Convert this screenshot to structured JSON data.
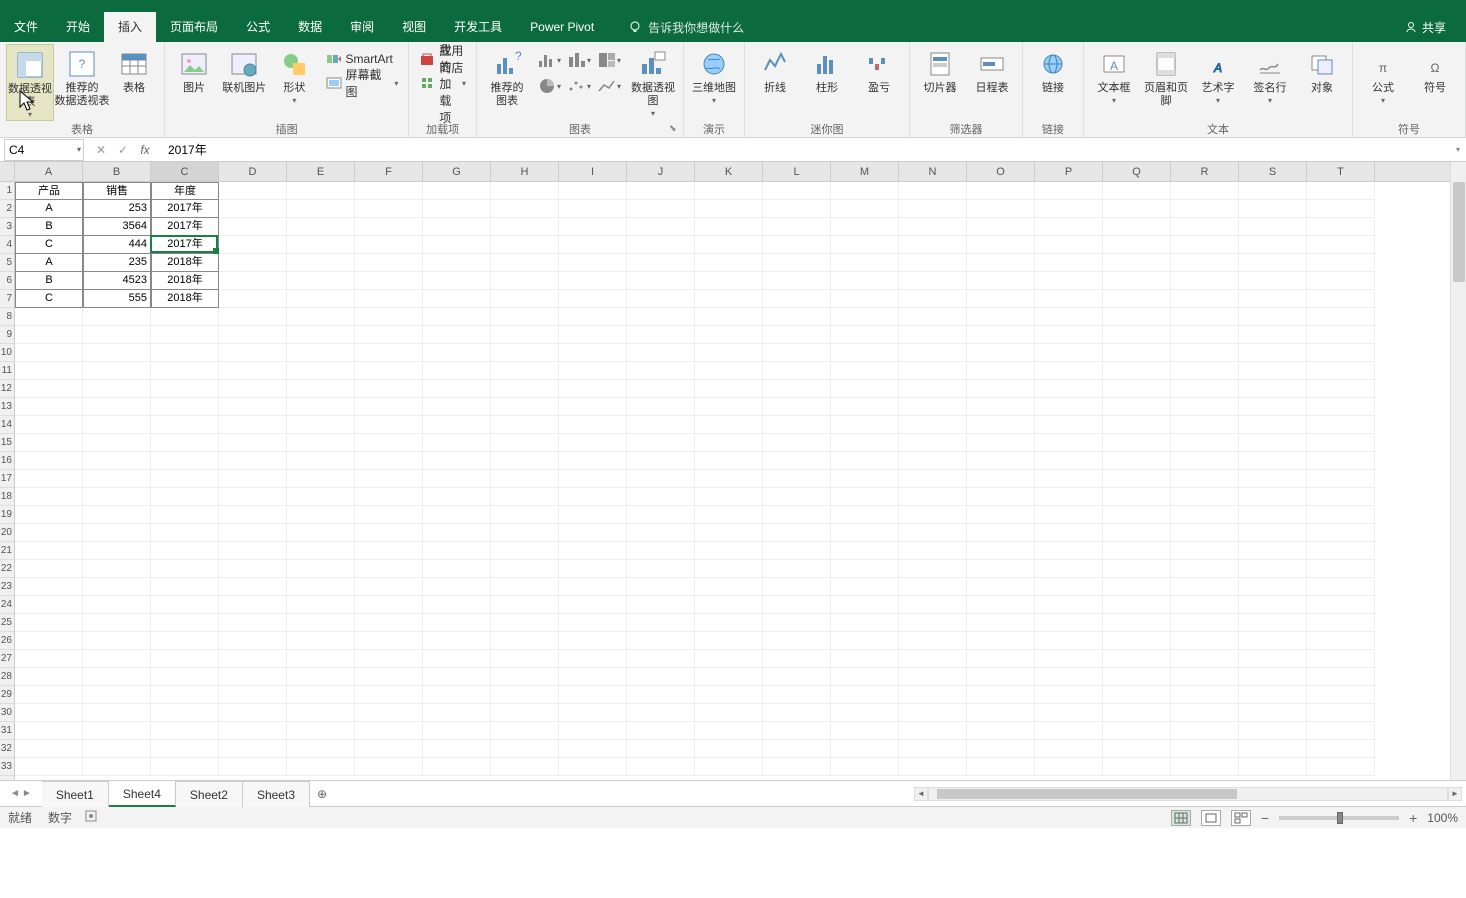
{
  "tabs": {
    "file": "文件",
    "home": "开始",
    "insert": "插入",
    "layout": "页面布局",
    "formula": "公式",
    "data": "数据",
    "review": "审阅",
    "view": "视图",
    "dev": "开发工具",
    "pivot": "Power Pivot"
  },
  "tell_me": "告诉我你想做什么",
  "share": "共享",
  "ribbon": {
    "tables": {
      "pivot": "数据透视表",
      "rec_pivot": "推荐的\n数据透视表",
      "table": "表格",
      "group": "表格"
    },
    "illus": {
      "pic": "图片",
      "online": "联机图片",
      "shape": "形状",
      "smartart": "SmartArt",
      "screenshot": "屏幕截图",
      "group": "插图"
    },
    "addins": {
      "store": "应用商店",
      "my": "我的加载项",
      "group": "加载项"
    },
    "charts": {
      "rec": "推荐的\n图表",
      "pivotchart": "数据透视图",
      "map3d": "三维地图",
      "group": "图表"
    },
    "tour": {
      "group": "演示"
    },
    "spark": {
      "line": "折线",
      "col": "柱形",
      "winloss": "盈亏",
      "group": "迷你图"
    },
    "filter": {
      "slicer": "切片器",
      "timeline": "日程表",
      "group": "筛选器"
    },
    "link": {
      "link": "链接",
      "group": "链接"
    },
    "text": {
      "textbox": "文本框",
      "header": "页眉和页脚",
      "wordart": "艺术字",
      "sig": "签名行",
      "obj": "对象",
      "group": "文本"
    },
    "symbol": {
      "eq": "公式",
      "sym": "符号",
      "group": "符号"
    }
  },
  "name_box": "C4",
  "formula": "2017年",
  "columns": [
    "A",
    "B",
    "C",
    "D",
    "E",
    "F",
    "G",
    "H",
    "I",
    "J",
    "K",
    "L",
    "M",
    "N",
    "O",
    "P",
    "Q",
    "R",
    "S",
    "T"
  ],
  "table": {
    "headers": [
      "产品",
      "销售",
      "年度"
    ],
    "rows": [
      [
        "A",
        "253",
        "2017年"
      ],
      [
        "B",
        "3564",
        "2017年"
      ],
      [
        "C",
        "444",
        "2017年"
      ],
      [
        "A",
        "235",
        "2018年"
      ],
      [
        "B",
        "4523",
        "2018年"
      ],
      [
        "C",
        "555",
        "2018年"
      ]
    ]
  },
  "sheets": [
    "Sheet1",
    "Sheet4",
    "Sheet2",
    "Sheet3"
  ],
  "active_sheet": "Sheet4",
  "status": {
    "ready": "就绪",
    "num": "数字"
  },
  "zoom": "100%"
}
